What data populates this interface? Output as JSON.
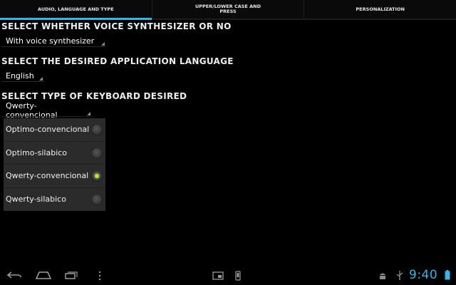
{
  "tabs": [
    {
      "label": "AUDIO, LANGUAGE AND TYPE",
      "selected": true
    },
    {
      "label": "UPPER/LOWER CASE AND PRESS",
      "selected": false
    },
    {
      "label": "PERSONALIZATION",
      "selected": false
    }
  ],
  "voice": {
    "title": "SELECT WHETHER VOICE SYNTHESIZER OR NO",
    "value": "With voice synthesizer"
  },
  "language": {
    "title": "SELECT THE DESIRED APPLICATION LANGUAGE",
    "value": "English"
  },
  "keyboard": {
    "title": "SELECT TYPE OF KEYBOARD DESIRED",
    "value": "Qwerty-convencional",
    "options": [
      {
        "label": "Optimo-convencional",
        "checked": false
      },
      {
        "label": "Optimo-silabico",
        "checked": false
      },
      {
        "label": "Qwerty-convencional",
        "checked": true
      },
      {
        "label": "Qwerty-silabico",
        "checked": false
      }
    ]
  },
  "system_bar": {
    "clock": "9:40",
    "icons": [
      "back-icon",
      "home-icon",
      "recent-apps-icon",
      "menu-icon",
      "screenshot-icon",
      "phone-icon",
      "android-debug-icon",
      "usb-icon",
      "battery-icon"
    ]
  },
  "colors": {
    "accent": "#33b5e5",
    "radio_checked": "#b7e34a",
    "background": "#000000"
  }
}
